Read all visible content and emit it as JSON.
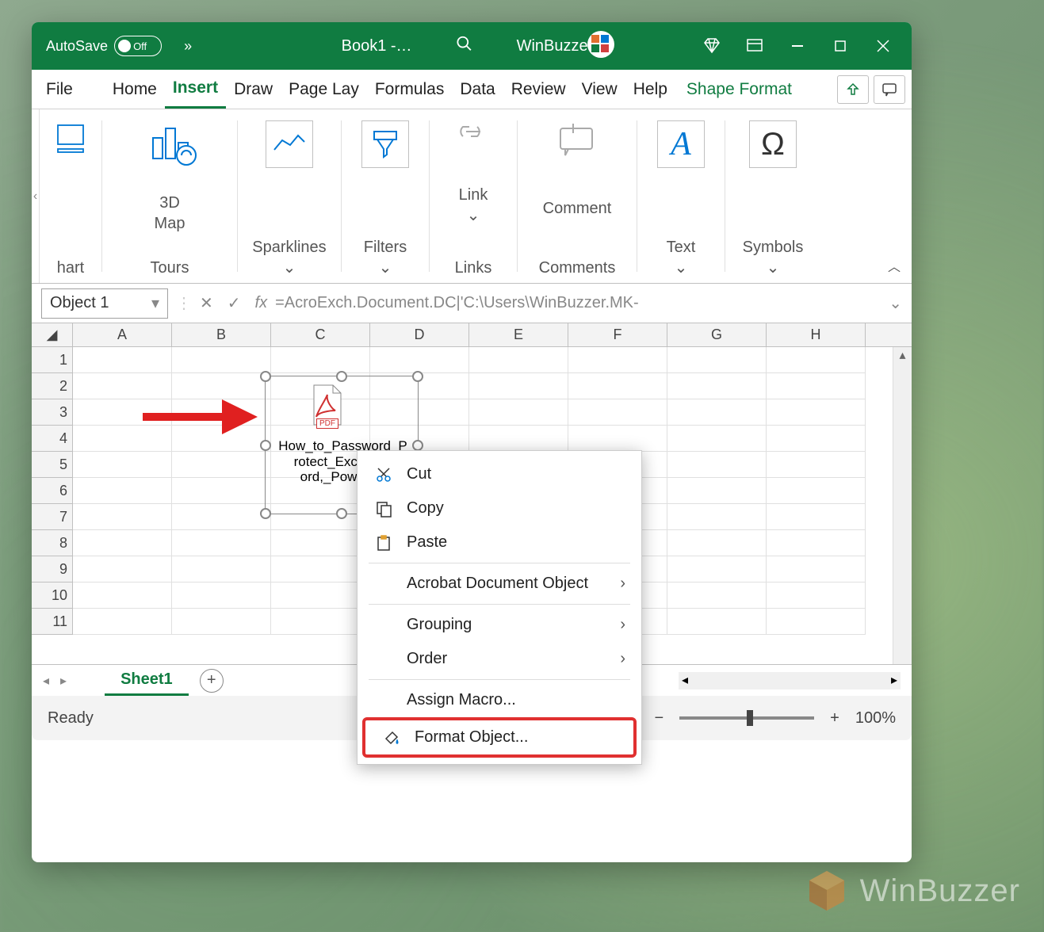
{
  "titlebar": {
    "autosave_label": "AutoSave",
    "autosave_state": "Off",
    "book_name": "Book1  -…",
    "user": "WinBuzzer ."
  },
  "tabs": {
    "file": "File",
    "home": "Home",
    "insert": "Insert",
    "draw": "Draw",
    "page": "Page Lay",
    "formulas": "Formulas",
    "data": "Data",
    "review": "Review",
    "view": "View",
    "help": "Help",
    "shape_format": "Shape Format"
  },
  "ribbon": {
    "chart_label": "hart",
    "map_label": "3D\nMap",
    "tours_label": "Tours",
    "sparklines_label": "Sparklines",
    "filters_label": "Filters",
    "link_label": "Link",
    "links_label": "Links",
    "comment_label": "Comment",
    "comments_label": "Comments",
    "text_label": "Text",
    "symbols_label": "Symbols"
  },
  "formula_bar": {
    "name": "Object 1",
    "formula": "=AcroExch.Document.DC|'C:\\Users\\WinBuzzer.MK-"
  },
  "grid": {
    "columns": [
      "A",
      "B",
      "C",
      "D",
      "E",
      "F",
      "G",
      "H"
    ],
    "rows": [
      1,
      2,
      3,
      4,
      5,
      6,
      7,
      8,
      9,
      10,
      11
    ],
    "object_caption": "How_to_Password_Protect_Excel,_Word,_PowerPo"
  },
  "pdf_label": "PDF",
  "sheet": {
    "name": "Sheet1"
  },
  "status": {
    "ready": "Ready",
    "zoom": "100%"
  },
  "context_menu": {
    "cut": "Cut",
    "copy": "Copy",
    "paste": "Paste",
    "acrobat": "Acrobat Document Object",
    "grouping": "Grouping",
    "order": "Order",
    "assign_macro": "Assign Macro...",
    "format_object": "Format Object..."
  },
  "watermark": "WinBuzzer"
}
